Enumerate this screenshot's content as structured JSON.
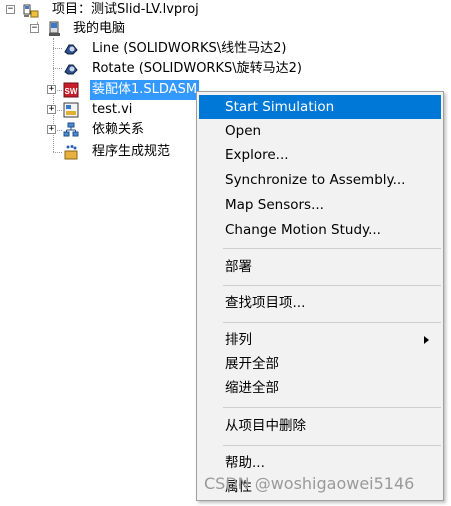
{
  "tree": {
    "project_label": "项目：测试Slid-LV.lvproj",
    "computer_label": "我的电脑",
    "items": [
      {
        "label": "Line (SOLIDWORKS\\线性马达2)",
        "icon": "motor-icon"
      },
      {
        "label": "Rotate (SOLIDWORKS\\旋转马达2)",
        "icon": "motor-icon"
      },
      {
        "label": "装配体1.SLDASM",
        "icon": "solidworks-assembly-icon",
        "selected": true
      },
      {
        "label": "test.vi",
        "icon": "vi-icon"
      },
      {
        "label": "依赖关系",
        "icon": "dependencies-icon"
      },
      {
        "label": "程序生成规范",
        "icon": "build-spec-icon"
      }
    ]
  },
  "context_menu": {
    "items": [
      {
        "label": "Start Simulation",
        "highlighted": true
      },
      {
        "label": "Open"
      },
      {
        "label": "Explore..."
      },
      {
        "label": "Synchronize to Assembly..."
      },
      {
        "label": "Map Sensors..."
      },
      {
        "label": "Change Motion Study..."
      },
      {
        "label": "部署"
      },
      {
        "label": "查找项目项..."
      },
      {
        "label": "排列",
        "submenu": true
      },
      {
        "label": "展开全部"
      },
      {
        "label": "缩进全部"
      },
      {
        "label": "从项目中删除"
      },
      {
        "label": "帮助..."
      },
      {
        "label": "属性"
      }
    ]
  },
  "watermark": "CSDN @woshigaowei5146",
  "colors": {
    "selection": "#3399ff",
    "menu_highlight": "#0078d7",
    "menu_background": "#f2f2f2"
  }
}
